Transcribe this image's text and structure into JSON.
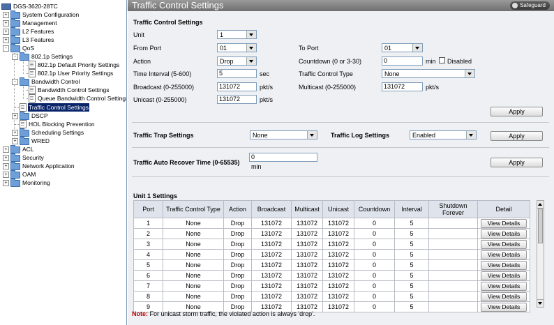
{
  "tree": {
    "root": "DGS-3620-28TC",
    "items": [
      {
        "label": "System Configuration",
        "expander": "+"
      },
      {
        "label": "Management",
        "expander": "+"
      },
      {
        "label": "L2 Features",
        "expander": "+"
      },
      {
        "label": "L3 Features",
        "expander": "+"
      },
      {
        "label": "QoS",
        "expander": "-"
      },
      {
        "label": "802.1p Settings",
        "expander": "-"
      },
      {
        "label": "802.1p Default Priority Settings"
      },
      {
        "label": "802.1p User Priority Settings"
      },
      {
        "label": "Bandwidth Control",
        "expander": "-"
      },
      {
        "label": "Bandwidth Control Settings"
      },
      {
        "label": "Queue Bandwidth Control Settings"
      },
      {
        "label": "Traffic Control Settings",
        "selected": true
      },
      {
        "label": "DSCP",
        "expander": "+"
      },
      {
        "label": "HOL Blocking Prevention"
      },
      {
        "label": "Scheduling Settings",
        "expander": "+"
      },
      {
        "label": "WRED",
        "expander": "+"
      },
      {
        "label": "ACL",
        "expander": "+"
      },
      {
        "label": "Security",
        "expander": "+"
      },
      {
        "label": "Network Application",
        "expander": "+"
      },
      {
        "label": "OAM",
        "expander": "+"
      },
      {
        "label": "Monitoring",
        "expander": "+"
      }
    ]
  },
  "header": {
    "title": "Traffic Control Settings",
    "safeguard": "Safeguard"
  },
  "form": {
    "section_title": "Traffic Control Settings",
    "unit_label": "Unit",
    "unit_value": "1",
    "from_port_label": "From Port",
    "from_port_value": "01",
    "to_port_label": "To Port",
    "to_port_value": "01",
    "action_label": "Action",
    "action_value": "Drop",
    "countdown_label": "Countdown (0 or 3-30)",
    "countdown_value": "0",
    "countdown_unit": "min",
    "disabled_label": "Disabled",
    "interval_label": "Time Interval (5-600)",
    "interval_value": "5",
    "interval_unit": "sec",
    "tct_label": "Traffic Control Type",
    "tct_value": "None",
    "broadcast_label": "Broadcast (0-255000)",
    "broadcast_value": "131072",
    "broadcast_unit": "pkt/s",
    "multicast_label": "Multicast (0-255000)",
    "multicast_value": "131072",
    "multicast_unit": "pkt/s",
    "unicast_label": "Unicast (0-255000)",
    "unicast_value": "131072",
    "unicast_unit": "pkt/s",
    "apply": "Apply"
  },
  "trap": {
    "trap_label": "Traffic Trap Settings",
    "trap_value": "None",
    "log_label": "Traffic Log Settings",
    "log_value": "Enabled",
    "apply": "Apply"
  },
  "recover": {
    "label": "Traffic Auto Recover Time (0-65535)",
    "value": "0",
    "unit": "min",
    "apply": "Apply"
  },
  "table": {
    "title": "Unit 1 Settings",
    "headers": [
      "Port",
      "Traffic Control Type",
      "Action",
      "Broadcast",
      "Multicast",
      "Unicast",
      "Countdown",
      "Interval",
      "Shutdown Forever",
      "Detail"
    ],
    "rows": [
      [
        "1",
        "None",
        "Drop",
        "131072",
        "131072",
        "131072",
        "0",
        "5",
        "",
        "View Details"
      ],
      [
        "2",
        "None",
        "Drop",
        "131072",
        "131072",
        "131072",
        "0",
        "5",
        "",
        "View Details"
      ],
      [
        "3",
        "None",
        "Drop",
        "131072",
        "131072",
        "131072",
        "0",
        "5",
        "",
        "View Details"
      ],
      [
        "4",
        "None",
        "Drop",
        "131072",
        "131072",
        "131072",
        "0",
        "5",
        "",
        "View Details"
      ],
      [
        "5",
        "None",
        "Drop",
        "131072",
        "131072",
        "131072",
        "0",
        "5",
        "",
        "View Details"
      ],
      [
        "6",
        "None",
        "Drop",
        "131072",
        "131072",
        "131072",
        "0",
        "5",
        "",
        "View Details"
      ],
      [
        "7",
        "None",
        "Drop",
        "131072",
        "131072",
        "131072",
        "0",
        "5",
        "",
        "View Details"
      ],
      [
        "8",
        "None",
        "Drop",
        "131072",
        "131072",
        "131072",
        "0",
        "5",
        "",
        "View Details"
      ],
      [
        "9",
        "None",
        "Drop",
        "131072",
        "131072",
        "131072",
        "0",
        "5",
        "",
        "View Details"
      ]
    ]
  },
  "note": {
    "label": "Note:",
    "text": " For unicast storm traffic, the violated action is always 'drop'."
  }
}
